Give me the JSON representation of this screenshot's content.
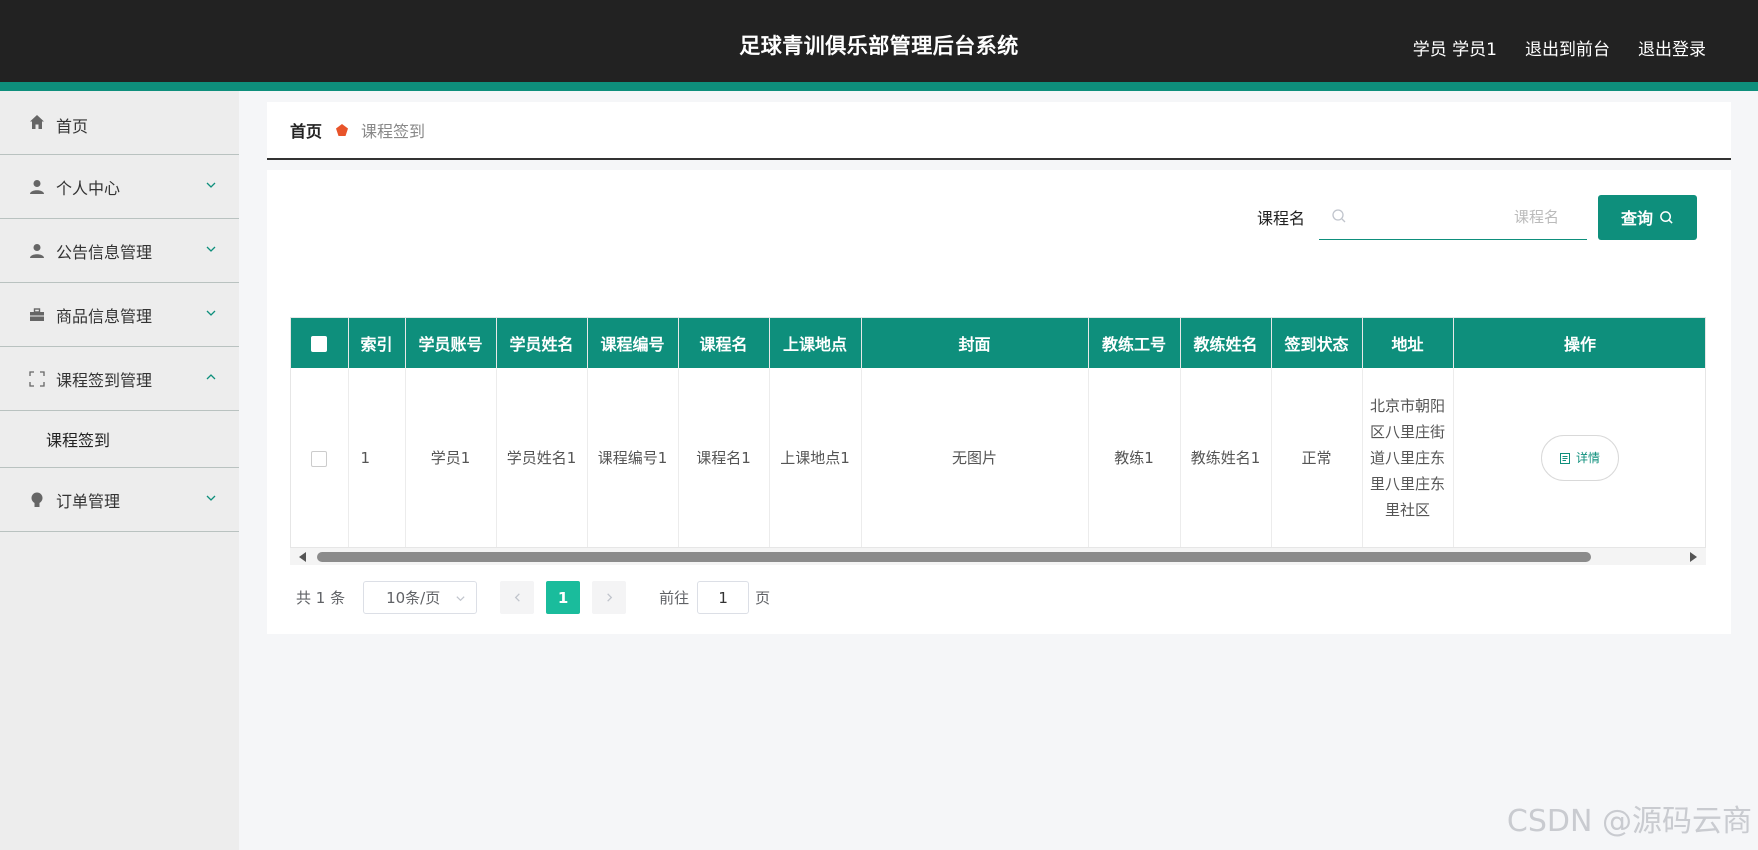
{
  "header": {
    "title": "足球青训俱乐部管理后台系统",
    "user_label": "学员 学员1",
    "back_front_label": "退出到前台",
    "logout_label": "退出登录"
  },
  "sidebar": {
    "items": [
      {
        "label": "首页",
        "icon": "home-icon"
      },
      {
        "label": "个人中心",
        "icon": "user-icon"
      },
      {
        "label": "公告信息管理",
        "icon": "user-icon"
      },
      {
        "label": "商品信息管理",
        "icon": "briefcase-icon"
      },
      {
        "label": "课程签到管理",
        "icon": "frame-icon",
        "expanded": true,
        "children": [
          {
            "label": "课程签到"
          }
        ]
      },
      {
        "label": "订单管理",
        "icon": "bulb-icon"
      }
    ]
  },
  "breadcrumb": {
    "home": "首页",
    "current": "课程签到"
  },
  "search": {
    "label": "课程名",
    "placeholder": "课程名",
    "button_label": "查询"
  },
  "table": {
    "headers": [
      "索引",
      "学员账号",
      "学员姓名",
      "课程编号",
      "课程名",
      "上课地点",
      "封面",
      "教练工号",
      "教练姓名",
      "签到状态",
      "地址",
      "操作"
    ],
    "rows": [
      {
        "index": "1",
        "student_account": "学员1",
        "student_name": "学员姓名1",
        "course_no": "课程编号1",
        "course_name": "课程名1",
        "location": "上课地点1",
        "cover": "无图片",
        "coach_no": "教练1",
        "coach_name": "教练姓名1",
        "status": "正常",
        "address": "北京市朝阳区八里庄街道八里庄东里八里庄东里社区",
        "action_label": "详情"
      }
    ]
  },
  "pagination": {
    "total": "共 1 条",
    "page_size": "10条/页",
    "current_page": "1",
    "goto_label": "前往",
    "goto_value": "1",
    "page_suffix": "页"
  },
  "watermark": "CSDN @源码云商",
  "colors": {
    "accent": "#0e8f7c",
    "header_bg": "#222222",
    "page_active": "#1abc9c"
  }
}
